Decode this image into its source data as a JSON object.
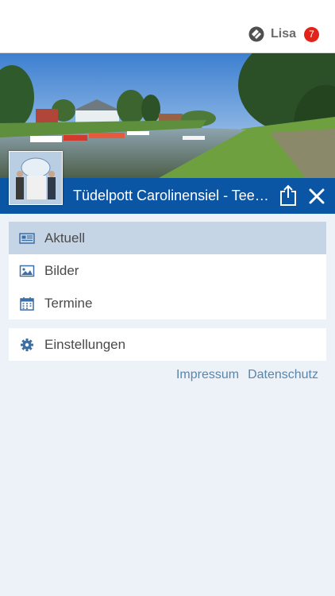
{
  "header": {
    "user_name": "Lisa",
    "notification_count": "7",
    "user_icon": "user-logo-icon"
  },
  "hero": {
    "title": "Tüdelpott Carolinensiel - Tees...",
    "share_icon": "share-icon",
    "close_icon": "close-icon"
  },
  "menu": {
    "primary": [
      {
        "label": "Aktuell",
        "icon": "newspaper-icon",
        "active": true
      },
      {
        "label": "Bilder",
        "icon": "image-icon",
        "active": false
      },
      {
        "label": "Termine",
        "icon": "calendar-icon",
        "active": false
      }
    ],
    "secondary": [
      {
        "label": "Einstellungen",
        "icon": "gear-icon"
      }
    ]
  },
  "footer_links": {
    "impressum": "Impressum",
    "datenschutz": "Datenschutz"
  },
  "colors": {
    "accent": "#0b56a4",
    "badge": "#e2231a",
    "active_item": "#c6d5e5",
    "link": "#5b86a8",
    "background": "#edf1f8"
  }
}
